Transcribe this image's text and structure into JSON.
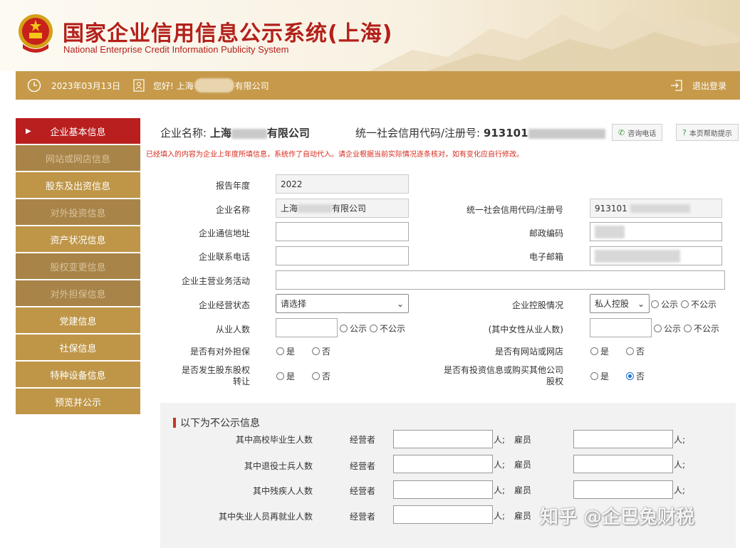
{
  "header": {
    "title": "国家企业信用信息公示系统(上海)",
    "subtitle": "National Enterprise Credit Information Publicity System"
  },
  "topbar": {
    "date": "2023年03月13日",
    "greeting_prefix": "您好! 上海",
    "greeting_suffix": "有限公司",
    "logout": "退出登录"
  },
  "sidebar": {
    "items": [
      {
        "label": "企业基本信息",
        "state": "active"
      },
      {
        "label": "网站或网店信息",
        "state": "faded"
      },
      {
        "label": "股东及出资信息",
        "state": "normal"
      },
      {
        "label": "对外投资信息",
        "state": "faded"
      },
      {
        "label": "资产状况信息",
        "state": "normal"
      },
      {
        "label": "股权变更信息",
        "state": "faded"
      },
      {
        "label": "对外担保信息",
        "state": "faded"
      },
      {
        "label": "党建信息",
        "state": "normal"
      },
      {
        "label": "社保信息",
        "state": "normal"
      },
      {
        "label": "特种设备信息",
        "state": "normal"
      },
      {
        "label": "预览并公示",
        "state": "normal"
      }
    ]
  },
  "main": {
    "company_label": "企业名称:",
    "company_prefix": "上海",
    "company_suffix": "有限公司",
    "credit_label": "统一社会信用代码/注册号:",
    "credit_prefix": "913101",
    "consult_button": "咨询电话",
    "help_button": "本页帮助提示",
    "notice": "已经填入的内容为企业上年度所填信息，系统作了自动代入。请企业根据当前实际情况逐条核对，如有变化应自行修改。"
  },
  "form": {
    "report_year_label": "报告年度",
    "report_year_value": "2022",
    "company_name_label": "企业名称",
    "company_name_prefix": "上海",
    "company_name_suffix": "有限公司",
    "credit_code_label": "统一社会信用代码/注册号",
    "credit_code_prefix": "913101",
    "address_label": "企业通信地址",
    "postcode_label": "邮政编码",
    "phone_label": "企业联系电话",
    "email_label": "电子邮箱",
    "business_label": "企业主营业务活动",
    "status_label": "企业经营状态",
    "status_value": "请选择",
    "holding_label": "企业控股情况",
    "holding_value": "私人控股",
    "employees_label": "从业人数",
    "female_label": "(其中女性从业人数)",
    "guarantee_label": "是否有对外担保",
    "website_label": "是否有网站或网店",
    "equity_transfer_label_1": "是否发生股东股权",
    "equity_transfer_label_2": "转让",
    "investment_label_1": "是否有投资信息或购买其他公司",
    "investment_label_2": "股权",
    "public": "公示",
    "not_public": "不公示",
    "yes": "是",
    "no": "否"
  },
  "non_public": {
    "title": "以下为不公示信息",
    "operator": "经营者",
    "employee": "雇员",
    "unit": "人;",
    "rows": [
      {
        "label": "其中高校毕业生人数"
      },
      {
        "label": "其中退役士兵人数"
      },
      {
        "label": "其中残疾人人数"
      },
      {
        "label": "其中失业人员再就业人数"
      }
    ]
  },
  "watermark": "知乎 @企巴兔财税",
  "colors": {
    "brand_red": "#b3201a",
    "gold": "#c69a4a",
    "active_red": "#b91f1f",
    "notice_red": "#d62b1e"
  }
}
